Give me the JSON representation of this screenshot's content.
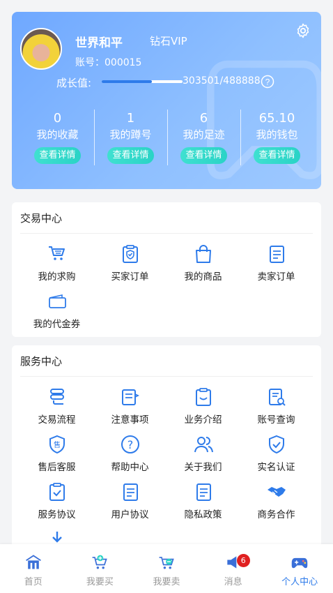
{
  "profile": {
    "username": "世界和平",
    "vip_level": "钻石VIP",
    "account": "账号：000015",
    "growth_label": "成长值:",
    "growth_value": "303501/488888",
    "growth_progress": 0.62
  },
  "stats": [
    {
      "value": "0",
      "label": "我的收藏",
      "button": "查看详情"
    },
    {
      "value": "1",
      "label": "我的蹲号",
      "button": "查看详情"
    },
    {
      "value": "6",
      "label": "我的足迹",
      "button": "查看详情"
    },
    {
      "value": "65.10",
      "label": "我的钱包",
      "button": "查看详情"
    }
  ],
  "trade_center": {
    "title": "交易中心",
    "items": [
      {
        "label": "我的求购",
        "icon": "cart-icon"
      },
      {
        "label": "买家订单",
        "icon": "shield-clipboard-icon"
      },
      {
        "label": "我的商品",
        "icon": "shopping-bag-icon"
      },
      {
        "label": "卖家订单",
        "icon": "document-icon"
      },
      {
        "label": "我的代金券",
        "icon": "wallet-icon"
      }
    ]
  },
  "service_center": {
    "title": "服务中心",
    "items": [
      {
        "label": "交易流程",
        "icon": "flow-icon"
      },
      {
        "label": "注意事项",
        "icon": "notice-icon"
      },
      {
        "label": "业务介绍",
        "icon": "clipboard-smile-icon"
      },
      {
        "label": "账号查询",
        "icon": "document-search-icon"
      },
      {
        "label": "售后客服",
        "icon": "after-sale-shield-icon"
      },
      {
        "label": "帮助中心",
        "icon": "question-icon"
      },
      {
        "label": "关于我们",
        "icon": "users-icon"
      },
      {
        "label": "实名认证",
        "icon": "verified-shield-icon"
      },
      {
        "label": "服务协议",
        "icon": "clipboard-check-icon"
      },
      {
        "label": "用户协议",
        "icon": "user-document-icon"
      },
      {
        "label": "隐私政策",
        "icon": "privacy-document-icon"
      },
      {
        "label": "商务合作",
        "icon": "handshake-icon"
      },
      {
        "label": "",
        "icon": "download-icon"
      }
    ]
  },
  "tabbar": [
    {
      "label": "首页",
      "icon": "home-icon",
      "active": false
    },
    {
      "label": "我要买",
      "icon": "buy-cart-icon",
      "active": false
    },
    {
      "label": "我要卖",
      "icon": "sell-cart-icon",
      "active": false
    },
    {
      "label": "消息",
      "icon": "message-icon",
      "active": false,
      "badge": "6"
    },
    {
      "label": "个人中心",
      "icon": "gamepad-icon",
      "active": true
    }
  ],
  "colors": {
    "accent": "#2e7bea",
    "card_gradient_start": "#6fa8ff",
    "button_teal": "#2ad3c6",
    "badge_red": "#e02020"
  }
}
